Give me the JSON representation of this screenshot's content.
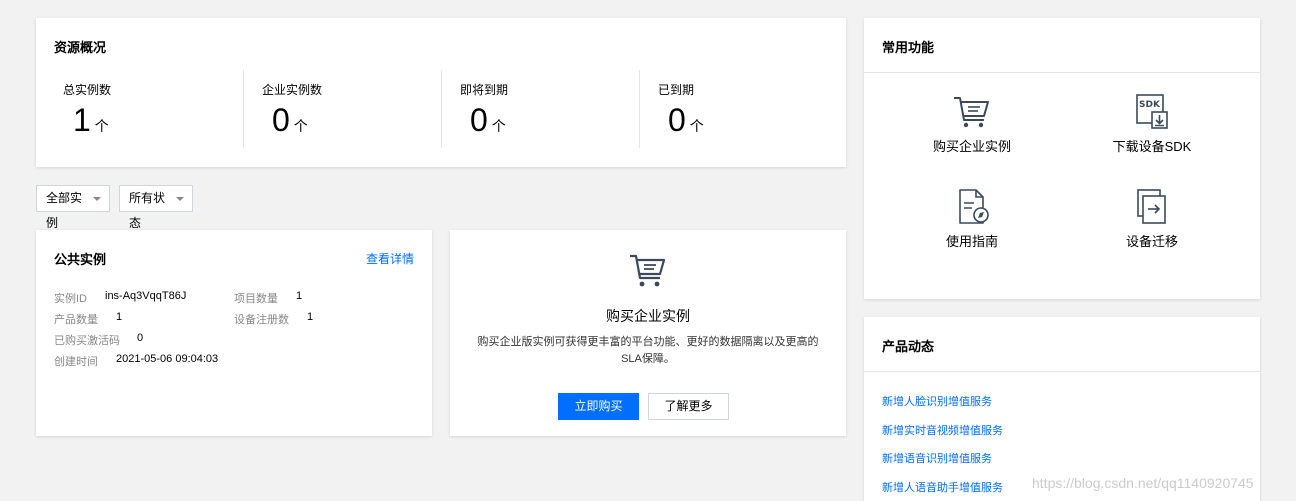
{
  "overview": {
    "title": "资源概况",
    "stats": [
      {
        "label": "总实例数",
        "value": "1",
        "unit": "个"
      },
      {
        "label": "企业实例数",
        "value": "0",
        "unit": "个"
      },
      {
        "label": "即将到期",
        "value": "0",
        "unit": "个"
      },
      {
        "label": "已到期",
        "value": "0",
        "unit": "个"
      }
    ]
  },
  "filters": {
    "instances": "全部实例",
    "status": "所有状态"
  },
  "public_instance": {
    "title": "公共实例",
    "details_link": "查看详情",
    "instance_id_label": "实例ID",
    "instance_id": "ins-Aq3VqqT86J",
    "project_count_label": "项目数量",
    "project_count": "1",
    "product_count_label": "产品数量",
    "product_count": "1",
    "device_reg_label": "设备注册数",
    "device_reg": "1",
    "activation_label": "已购买激活码",
    "activation": "0",
    "created_label": "创建时间",
    "created": "2021-05-06 09:04:03"
  },
  "buy": {
    "title": "购买企业实例",
    "description": "购买企业版实例可获得更丰富的平台功能、更好的数据隔离以及更高的SLA保障。",
    "buy_button": "立即购买",
    "learn_button": "了解更多"
  },
  "common": {
    "title": "常用功能",
    "items": [
      {
        "label": "购买企业实例",
        "icon": "cart-icon"
      },
      {
        "label": "下载设备SDK",
        "icon": "sdk-download-icon"
      },
      {
        "label": "使用指南",
        "icon": "guide-icon"
      },
      {
        "label": "设备迁移",
        "icon": "migrate-icon"
      }
    ]
  },
  "news": {
    "title": "产品动态",
    "items": [
      "新增人脸识别增值服务",
      "新增实时音视频增值服务",
      "新增语音识别增值服务",
      "新增人语音助手增值服务"
    ]
  },
  "watermark": "https://blog.csdn.net/qq1140920745",
  "colors": {
    "accent": "#006eff",
    "background": "#f2f2f2",
    "icon": "#3a4a5c"
  }
}
